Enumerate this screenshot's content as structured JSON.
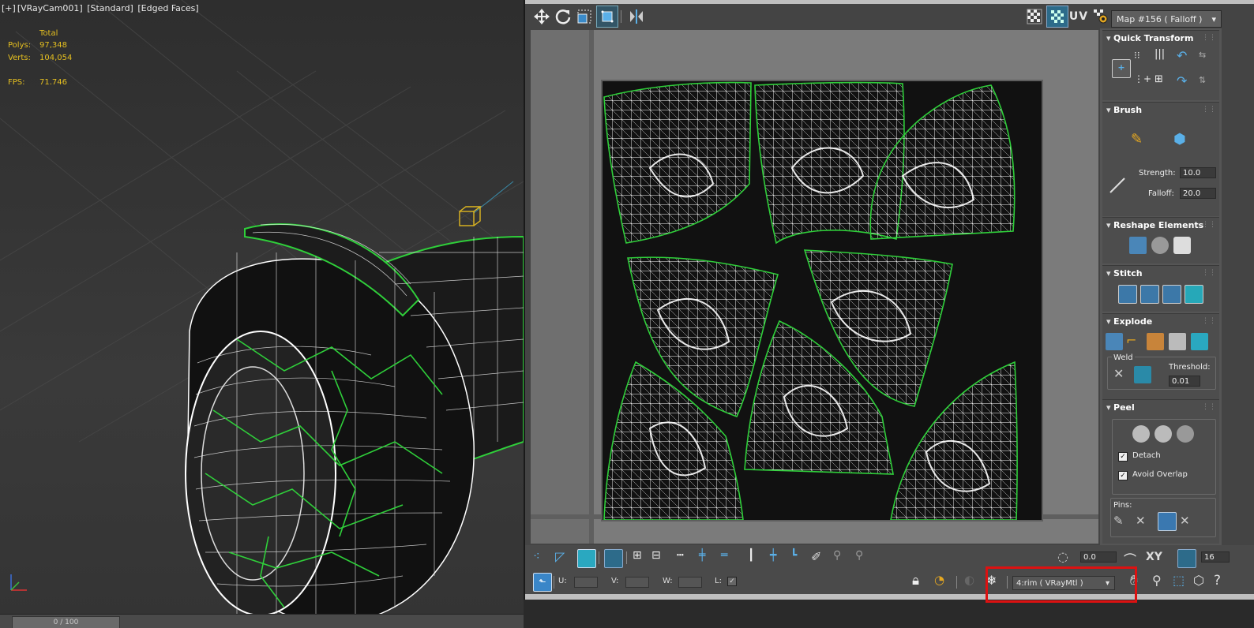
{
  "viewport": {
    "label_parts": [
      "[+]",
      "[VRayCam001]",
      "[Standard]",
      "[Edged Faces]"
    ],
    "stats": {
      "header": "Total",
      "polys_label": "Polys:",
      "polys_value": "97,348",
      "verts_label": "Verts:",
      "verts_value": "104,054",
      "fps_label": "FPS:",
      "fps_value": "71.746"
    },
    "timeslider_label": "0 / 100"
  },
  "editor": {
    "uv_label": "UV",
    "map_dropdown": "Map #156  ( Falloff )",
    "rollouts": {
      "quick_transform": "Quick Transform",
      "brush": "Brush",
      "reshape": "Reshape Elements",
      "stitch": "Stitch",
      "explode": "Explode",
      "peel": "Peel"
    },
    "brush": {
      "strength_label": "Strength:",
      "strength_value": "10.0",
      "falloff_label": "Falloff:",
      "falloff_value": "20.0"
    },
    "explode": {
      "weld_label": "Weld",
      "threshold_label": "Threshold:",
      "threshold_value": "0.01"
    },
    "peel": {
      "detach_label": "Detach",
      "avoid_overlap_label": "Avoid Overlap",
      "pins_label": "Pins:"
    },
    "bottom1": {
      "angle_value": "0.0",
      "xy_label": "XY",
      "grid_value": "16"
    },
    "bottom2": {
      "u_label": "U:",
      "v_label": "V:",
      "w_label": "W:",
      "l_label": "L:",
      "material_dropdown": "4:rim  ( VRayMtl )"
    }
  }
}
